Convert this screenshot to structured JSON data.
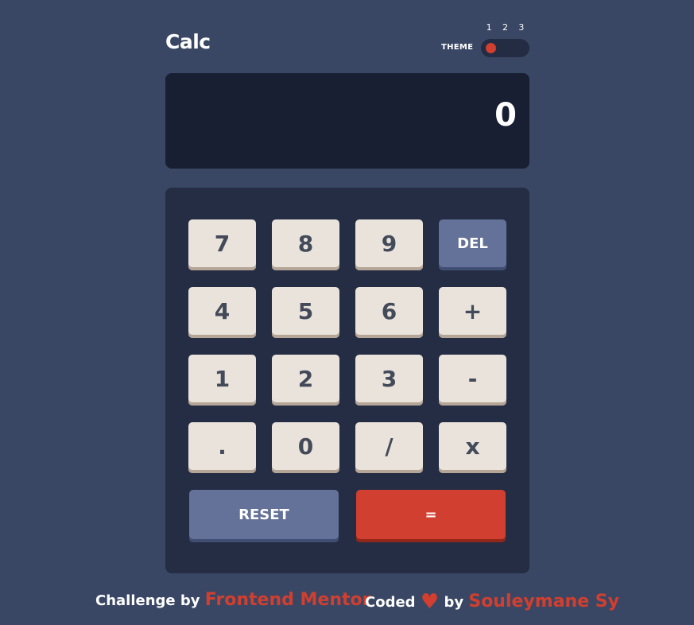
{
  "app": {
    "title": "Calc"
  },
  "theme": {
    "label": "THEME",
    "options": [
      "1",
      "2",
      "3"
    ],
    "selected": 1
  },
  "display": {
    "value": "0"
  },
  "keys": {
    "row1": [
      "7",
      "8",
      "9",
      "DEL"
    ],
    "row2": [
      "4",
      "5",
      "6",
      "+"
    ],
    "row3": [
      "1",
      "2",
      "3",
      "-"
    ],
    "row4": [
      ".",
      "0",
      "/",
      "x"
    ],
    "reset": "RESET",
    "equals": "="
  },
  "footer": {
    "challenge_by": "Challenge by",
    "challenge_link": "Frontend Mentor",
    "coded": "Coded",
    "by": "by",
    "author_link": "Souleymane Sy"
  },
  "colors": {
    "background": "#3a4764",
    "screen": "#181f32",
    "keypad": "#242d44",
    "key": "#eae3dc",
    "key_shadow": "#b4a597",
    "key_text": "#434a59",
    "function_key": "#647198",
    "equals_key": "#d03f2f",
    "accent": "#d03f2f"
  },
  "icons": {
    "heart": "heart-icon"
  }
}
